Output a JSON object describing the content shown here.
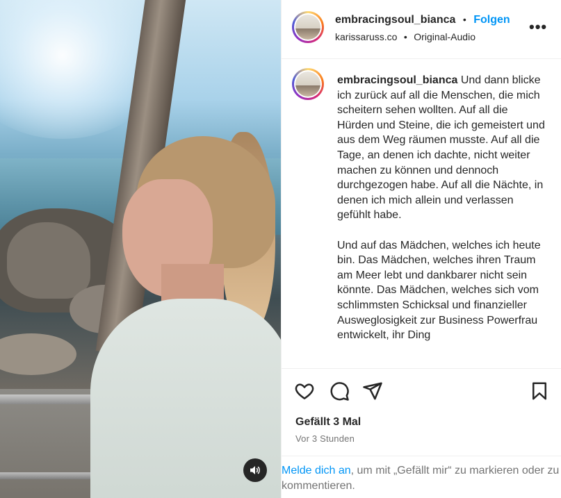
{
  "post": {
    "username": "embracingsoul_bianca",
    "follow_label": "Folgen",
    "separator": "•",
    "location_or_tag": "karissaruss.co",
    "audio": "Original-Audio",
    "more_icon": "more-dots-icon"
  },
  "caption": {
    "username": "embracingsoul_bianca",
    "text": " Und dann blicke ich zurück auf all die Menschen, die mich scheitern sehen wollten. Auf all die Hürden und Steine, die ich gemeistert und aus dem Weg räumen musste. Auf all die Tage, an denen ich dachte, nicht weiter machen zu können und dennoch durchgezogen habe. Auf all die Nächte, in denen ich mich allein und verlassen gefühlt habe.\n\nUnd auf das Mädchen, welches ich heute bin. Das Mädchen, welches ihren Traum am Meer lebt und dankbarer nicht sein könnte. Das Mädchen, welches sich vom schlimmsten Schicksal und finanzieller Ausweglosigkeit zur Business Powerfrau entwickelt, ihr Ding"
  },
  "actions": {
    "icons": [
      "heart-icon",
      "comment-icon",
      "share-icon",
      "bookmark-icon"
    ],
    "likes": "Gefällt 3 Mal",
    "time": "Vor 3 Stunden"
  },
  "login_prompt": {
    "link": "Melde dich an",
    "text": ", um mit „Gefällt mir“ zu markieren oder zu kommentieren."
  },
  "media": {
    "sound_icon": "speaker-icon"
  }
}
